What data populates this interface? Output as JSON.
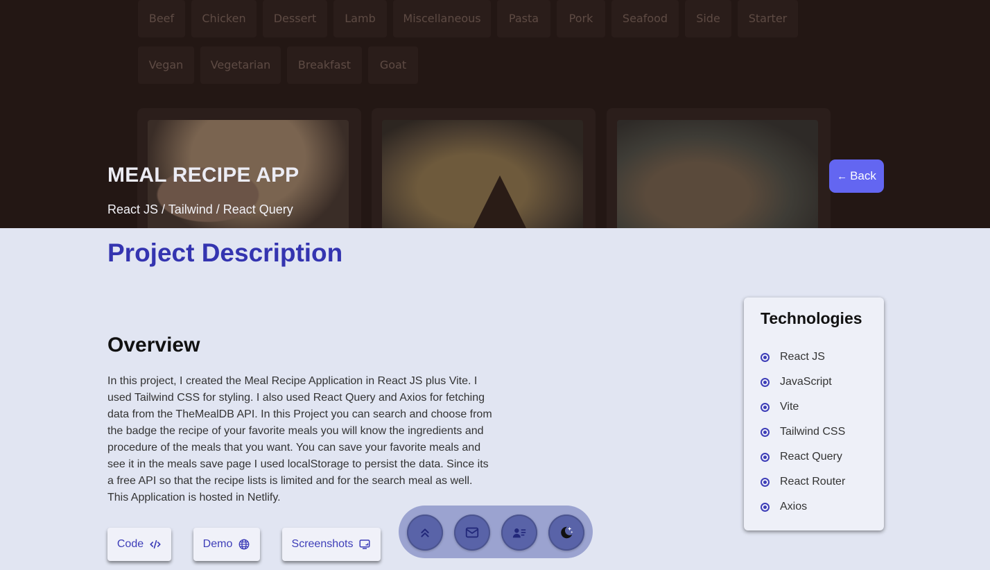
{
  "background": {
    "categories_row1": [
      "Beef",
      "Chicken",
      "Dessert",
      "Lamb",
      "Miscellaneous",
      "Pasta",
      "Pork",
      "Seafood",
      "Side",
      "Starter"
    ],
    "categories_row2": [
      "Vegan",
      "Vegetarian",
      "Breakfast",
      "Goat"
    ]
  },
  "hero": {
    "title": "MEAL RECIPE APP",
    "subtitle": "React JS / Tailwind / React Query",
    "back_label": "Back"
  },
  "main": {
    "section_title": "Project Description",
    "overview_heading": "Overview",
    "overview_text": "In this project, I created the Meal Recipe Application in React JS plus Vite. I used Tailwind CSS for styling. I also used React Query and Axios for fetching data from the TheMealDB API. In this Project you can search and choose from the badge the recipe of your favorite meals you will know the ingredients and procedure of the meals that you want. You can save your favorite meals and see it in the meals save page I used localStorage to persist the data. Since its a free API so that the recipe lists is limited and for the search meal as well. This Application is hosted in Netlify.",
    "buttons": {
      "code": "Code",
      "demo": "Demo",
      "screenshots": "Screenshots"
    }
  },
  "technologies": {
    "title": "Technologies",
    "items": [
      "React JS",
      "JavaScript",
      "Vite",
      "Tailwind CSS",
      "React Query",
      "React Router",
      "Axios"
    ]
  },
  "dock": {
    "icons": [
      "scroll-top-icon",
      "mail-icon",
      "contact-card-icon",
      "dark-mode-icon"
    ]
  },
  "colors": {
    "accent": "#6366f1",
    "heading": "#3434b0",
    "background": "#e1e5f2"
  }
}
